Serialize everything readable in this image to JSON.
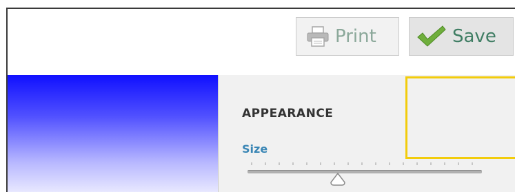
{
  "toolbar": {
    "print_label": "Print",
    "print_icon": "printer-icon",
    "save_label": "Save",
    "save_icon": "checkmark-icon"
  },
  "appearance": {
    "title": "APPEARANCE",
    "reset_icon": "reset-icon",
    "close_icon": "close-icon",
    "size_label": "Size"
  },
  "colors": {
    "gradient_top": "#1010ff",
    "gradient_bottom": "#e8e8ff",
    "size_label": "#3a86b5",
    "save_text": "#3f7d63",
    "close_red": "#d9381e",
    "reset_blue": "#2f7fc1",
    "highlight": "#f2cc0c"
  }
}
